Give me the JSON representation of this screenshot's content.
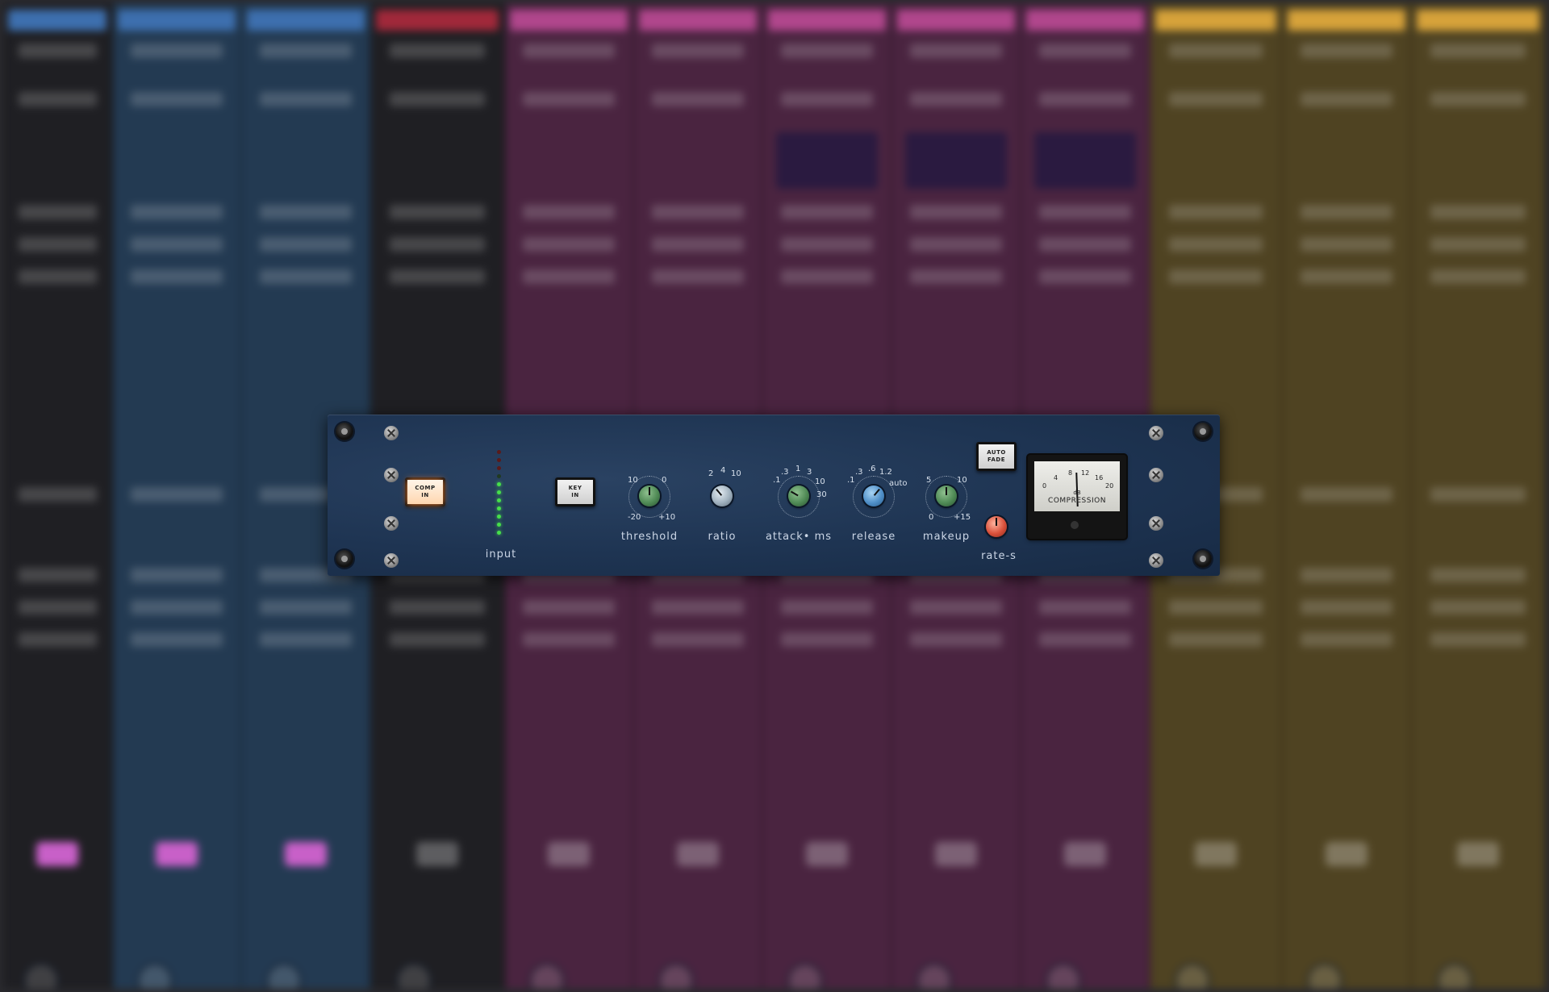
{
  "mixer": {
    "strips": [
      {
        "color": "#3d6fae",
        "body": "#1f1f23"
      },
      {
        "color": "#3d6fae",
        "body": "#233a52"
      },
      {
        "color": "#3d6fae",
        "body": "#233a52"
      },
      {
        "color": "#a0283a",
        "body": "#1f1f23"
      },
      {
        "color": "#b0468c",
        "body": "#4a2440"
      },
      {
        "color": "#b0468c",
        "body": "#4a2440"
      },
      {
        "color": "#b0468c",
        "body": "#4a2440"
      },
      {
        "color": "#b0468c",
        "body": "#4a2440"
      },
      {
        "color": "#b0468c",
        "body": "#4a2440"
      },
      {
        "color": "#d6a23a",
        "body": "#4f4322"
      },
      {
        "color": "#d6a23a",
        "body": "#4f4322"
      },
      {
        "color": "#d6a23a",
        "body": "#4f4322"
      }
    ]
  },
  "plugin": {
    "comp_in": {
      "line1": "COMP",
      "line2": "IN",
      "active": true
    },
    "key_in": {
      "line1": "KEY",
      "line2": "IN",
      "active": false
    },
    "auto_fade": {
      "line1": "AUTO",
      "line2": "FADE",
      "active": false
    },
    "input": {
      "label": "input",
      "leds_lit": 7,
      "leds_total": 11
    },
    "threshold": {
      "label": "threshold",
      "scale": [
        "10",
        "0",
        "-20",
        "+10"
      ],
      "color": "#4f8a55"
    },
    "ratio": {
      "label": "ratio",
      "scale": [
        "2",
        "4",
        "10"
      ],
      "color": "#9fb0bd"
    },
    "attack": {
      "label": "attack• ms",
      "scale": [
        ".1",
        ".3",
        "1",
        "3",
        "10",
        "30"
      ],
      "color": "#4f8a55"
    },
    "release": {
      "label": "release",
      "scale": [
        ".1",
        ".3",
        ".6",
        "1.2",
        "auto"
      ],
      "color": "#4f8fc8"
    },
    "makeup": {
      "label": "makeup",
      "scale": [
        "5",
        "10",
        "0",
        "+15"
      ],
      "color": "#4f8a55"
    },
    "rate": {
      "label": "rate-s",
      "color": "#d8503a"
    },
    "meter": {
      "title": "COMPRESSION",
      "unit": "dB",
      "ticks": [
        "0",
        "4",
        "8",
        "12",
        "16",
        "20"
      ]
    }
  }
}
